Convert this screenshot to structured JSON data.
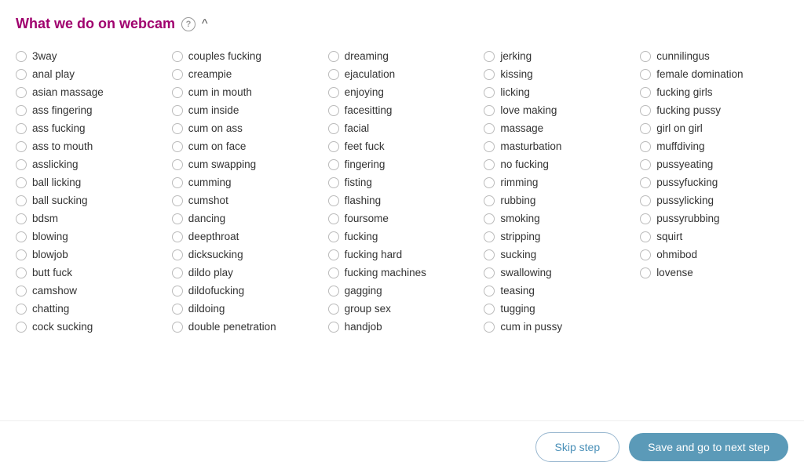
{
  "section": {
    "title": "What we do on webcam",
    "help_label": "?",
    "collapse_label": "^"
  },
  "columns": [
    [
      "3way",
      "anal play",
      "asian massage",
      "ass fingering",
      "ass fucking",
      "ass to mouth",
      "asslicking",
      "ball licking",
      "ball sucking",
      "bdsm",
      "blowing",
      "blowjob",
      "butt fuck",
      "camshow",
      "chatting",
      "cock sucking"
    ],
    [
      "couples fucking",
      "creampie",
      "cum in mouth",
      "cum inside",
      "cum on ass",
      "cum on face",
      "cum swapping",
      "cumming",
      "cumshot",
      "dancing",
      "deepthroat",
      "dicksucking",
      "dildo play",
      "dildofucking",
      "dildoing",
      "double penetration"
    ],
    [
      "dreaming",
      "ejaculation",
      "enjoying",
      "facesitting",
      "facial",
      "feet fuck",
      "fingering",
      "fisting",
      "flashing",
      "foursome",
      "fucking",
      "fucking hard",
      "fucking machines",
      "gagging",
      "group sex",
      "handjob"
    ],
    [
      "jerking",
      "kissing",
      "licking",
      "love making",
      "massage",
      "masturbation",
      "no fucking",
      "rimming",
      "rubbing",
      "smoking",
      "stripping",
      "sucking",
      "swallowing",
      "teasing",
      "tugging",
      "cum in pussy"
    ],
    [
      "cunnilingus",
      "female domination",
      "fucking girls",
      "fucking pussy",
      "girl on girl",
      "muffdiving",
      "pussyeating",
      "pussyfucking",
      "pussylicking",
      "pussyrubbing",
      "squirt",
      "ohmibod",
      "lovense",
      "",
      "",
      ""
    ]
  ],
  "footer": {
    "skip_label": "Skip step",
    "save_label": "Save and go to next step"
  }
}
